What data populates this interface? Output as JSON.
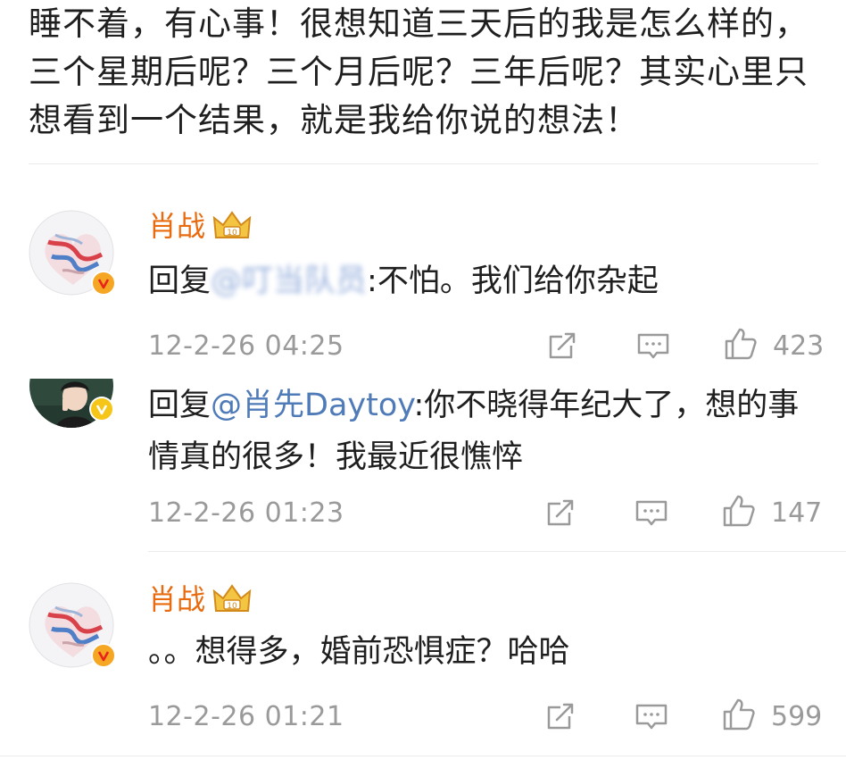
{
  "post": {
    "text": "睡不着，有心事！很想知道三天后的我是怎么样的，三个星期后呢？三个月后呢？三年后呢？其实心里只想看到一个结果，就是我给你说的想法！"
  },
  "comments": [
    {
      "username": "肖战",
      "reply_prefix": "回复",
      "mention": "@叮当队员",
      "separator": ":",
      "body": "不怕。我们给你杂起",
      "timestamp": "12-2-26 04:25",
      "likes": "423",
      "avatar_icon": "painted-heart-avatar",
      "badge_color": "#f5a623"
    },
    {
      "username": "",
      "reply_prefix": "回复",
      "mention": "@肖先Daytoy",
      "separator": ":",
      "body": "你不晓得年纪大了，想的事情真的很多！我最近很憔悴",
      "timestamp": "12-2-26 01:23",
      "likes": "147",
      "avatar_icon": "person-photo-avatar",
      "badge_color": "#f5c518"
    },
    {
      "username": "肖战",
      "reply_prefix": "",
      "mention": "",
      "separator": "",
      "body": "。。想得多，婚前恐惧症？哈哈",
      "timestamp": "12-2-26 01:21",
      "likes": "599",
      "avatar_icon": "painted-heart-avatar",
      "badge_color": "#f5a623"
    }
  ],
  "icons": {
    "share": "share-icon",
    "comment": "comment-icon",
    "like": "like-icon",
    "crown": "crown-badge-icon",
    "verified": "verified-badge-icon"
  },
  "colors": {
    "username": "#e86b0f",
    "mention": "#4f7bb8",
    "meta": "#9a9a9a",
    "text": "#1f1f1f"
  }
}
